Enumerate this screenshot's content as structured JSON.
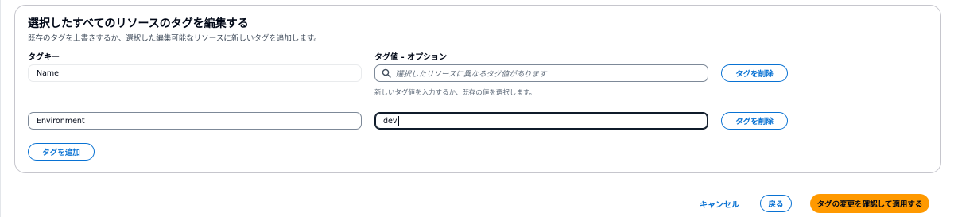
{
  "panel": {
    "title": "選択したすべてのリソースのタグを編集する",
    "description": "既存のタグを上書きするか、選択した編集可能なリソースに新しいタグを追加します。",
    "key_label": "タグキー",
    "value_label": "タグ値 - オプション",
    "tags": [
      {
        "key": "Name",
        "value_placeholder": "選択したリソースに異なるタグ値があります",
        "value_hint": "新しいタグ値を入力するか、既存の値を選択します。",
        "remove_label": "タグを削除"
      },
      {
        "key": "Environment",
        "value": "dev",
        "remove_label": "タグを削除"
      }
    ],
    "add_tag_label": "タグを追加"
  },
  "footer": {
    "cancel_label": "キャンセル",
    "back_label": "戻る",
    "confirm_label": "タグの変更を確認して適用する"
  },
  "icons": {
    "search": "search-icon"
  },
  "colors": {
    "link": "#0972d3",
    "primary": "#ff9900",
    "text": "#000716"
  }
}
